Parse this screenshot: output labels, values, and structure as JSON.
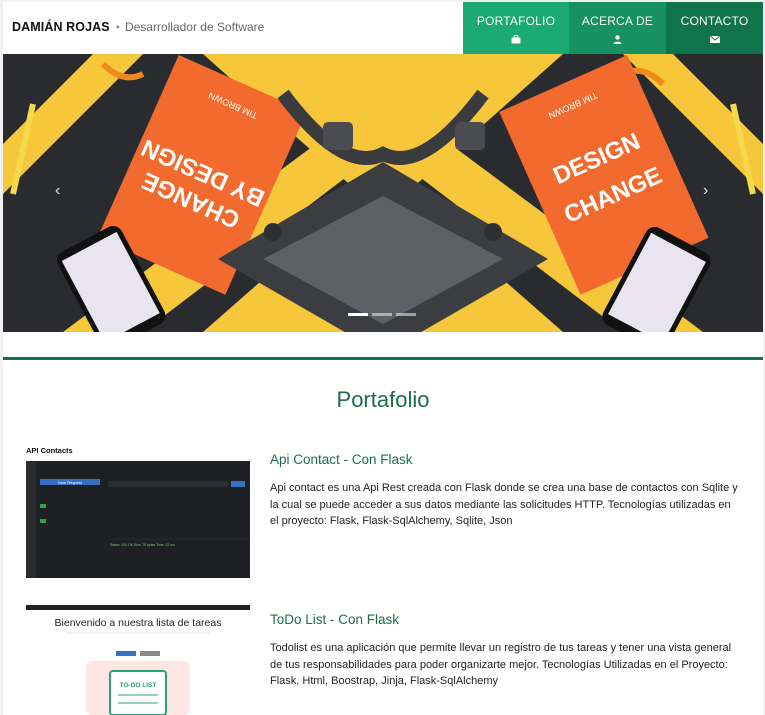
{
  "header": {
    "brand_name": "DAMIÁN ROJAS",
    "separator": "•",
    "tagline": "Desarrollador de Software",
    "nav": [
      {
        "label": "PORTAFOLIO",
        "icon": "briefcase-icon"
      },
      {
        "label": "ACERCA DE",
        "icon": "user-icon"
      },
      {
        "label": "CONTACTO",
        "icon": "envelope-icon"
      }
    ]
  },
  "carousel": {
    "prev": "‹",
    "next": "›",
    "slides": 3,
    "active": 1,
    "book_title_top": "TIM BROWN",
    "book_title_main": "CHANGE BY DESIGN"
  },
  "portfolio": {
    "heading": "Portafolio",
    "projects": [
      {
        "title": "Api Contact - Con Flask",
        "description": "Api contact es una Api Rest creada con Flask donde se crea una base de contactos con Sqlite y la cual se puede acceder a sus datos mediante las solicitudes HTTP. Tecnologías utilizadas en el proyecto: Flask, Flask-SqlAlchemy, Sqlite, Json",
        "image_caption": "API Contacts",
        "image_button": "New Request",
        "image_status": "Status: 200 OK  Size: 79 bytes  Time: 12 ms"
      },
      {
        "title": "ToDo List - Con Flask",
        "description": "Todolist es una aplicación que permite llevar un registro de tus tareas y tener una vista general de tus responsabilidades para poder organizarte mejor. Tecnologías Utilizadas en el Proyecto: Flask, Html, Boostrap, Jinja, Flask-SqlAlchemy",
        "image_caption": "Bienvenido a nuestra lista de tareas",
        "image_badge": "TO-DO LIST"
      }
    ]
  },
  "colors": {
    "nav_1": "#1aaa72",
    "nav_2": "#16915f",
    "nav_3": "#10744b",
    "accent": "#1a6e48"
  }
}
